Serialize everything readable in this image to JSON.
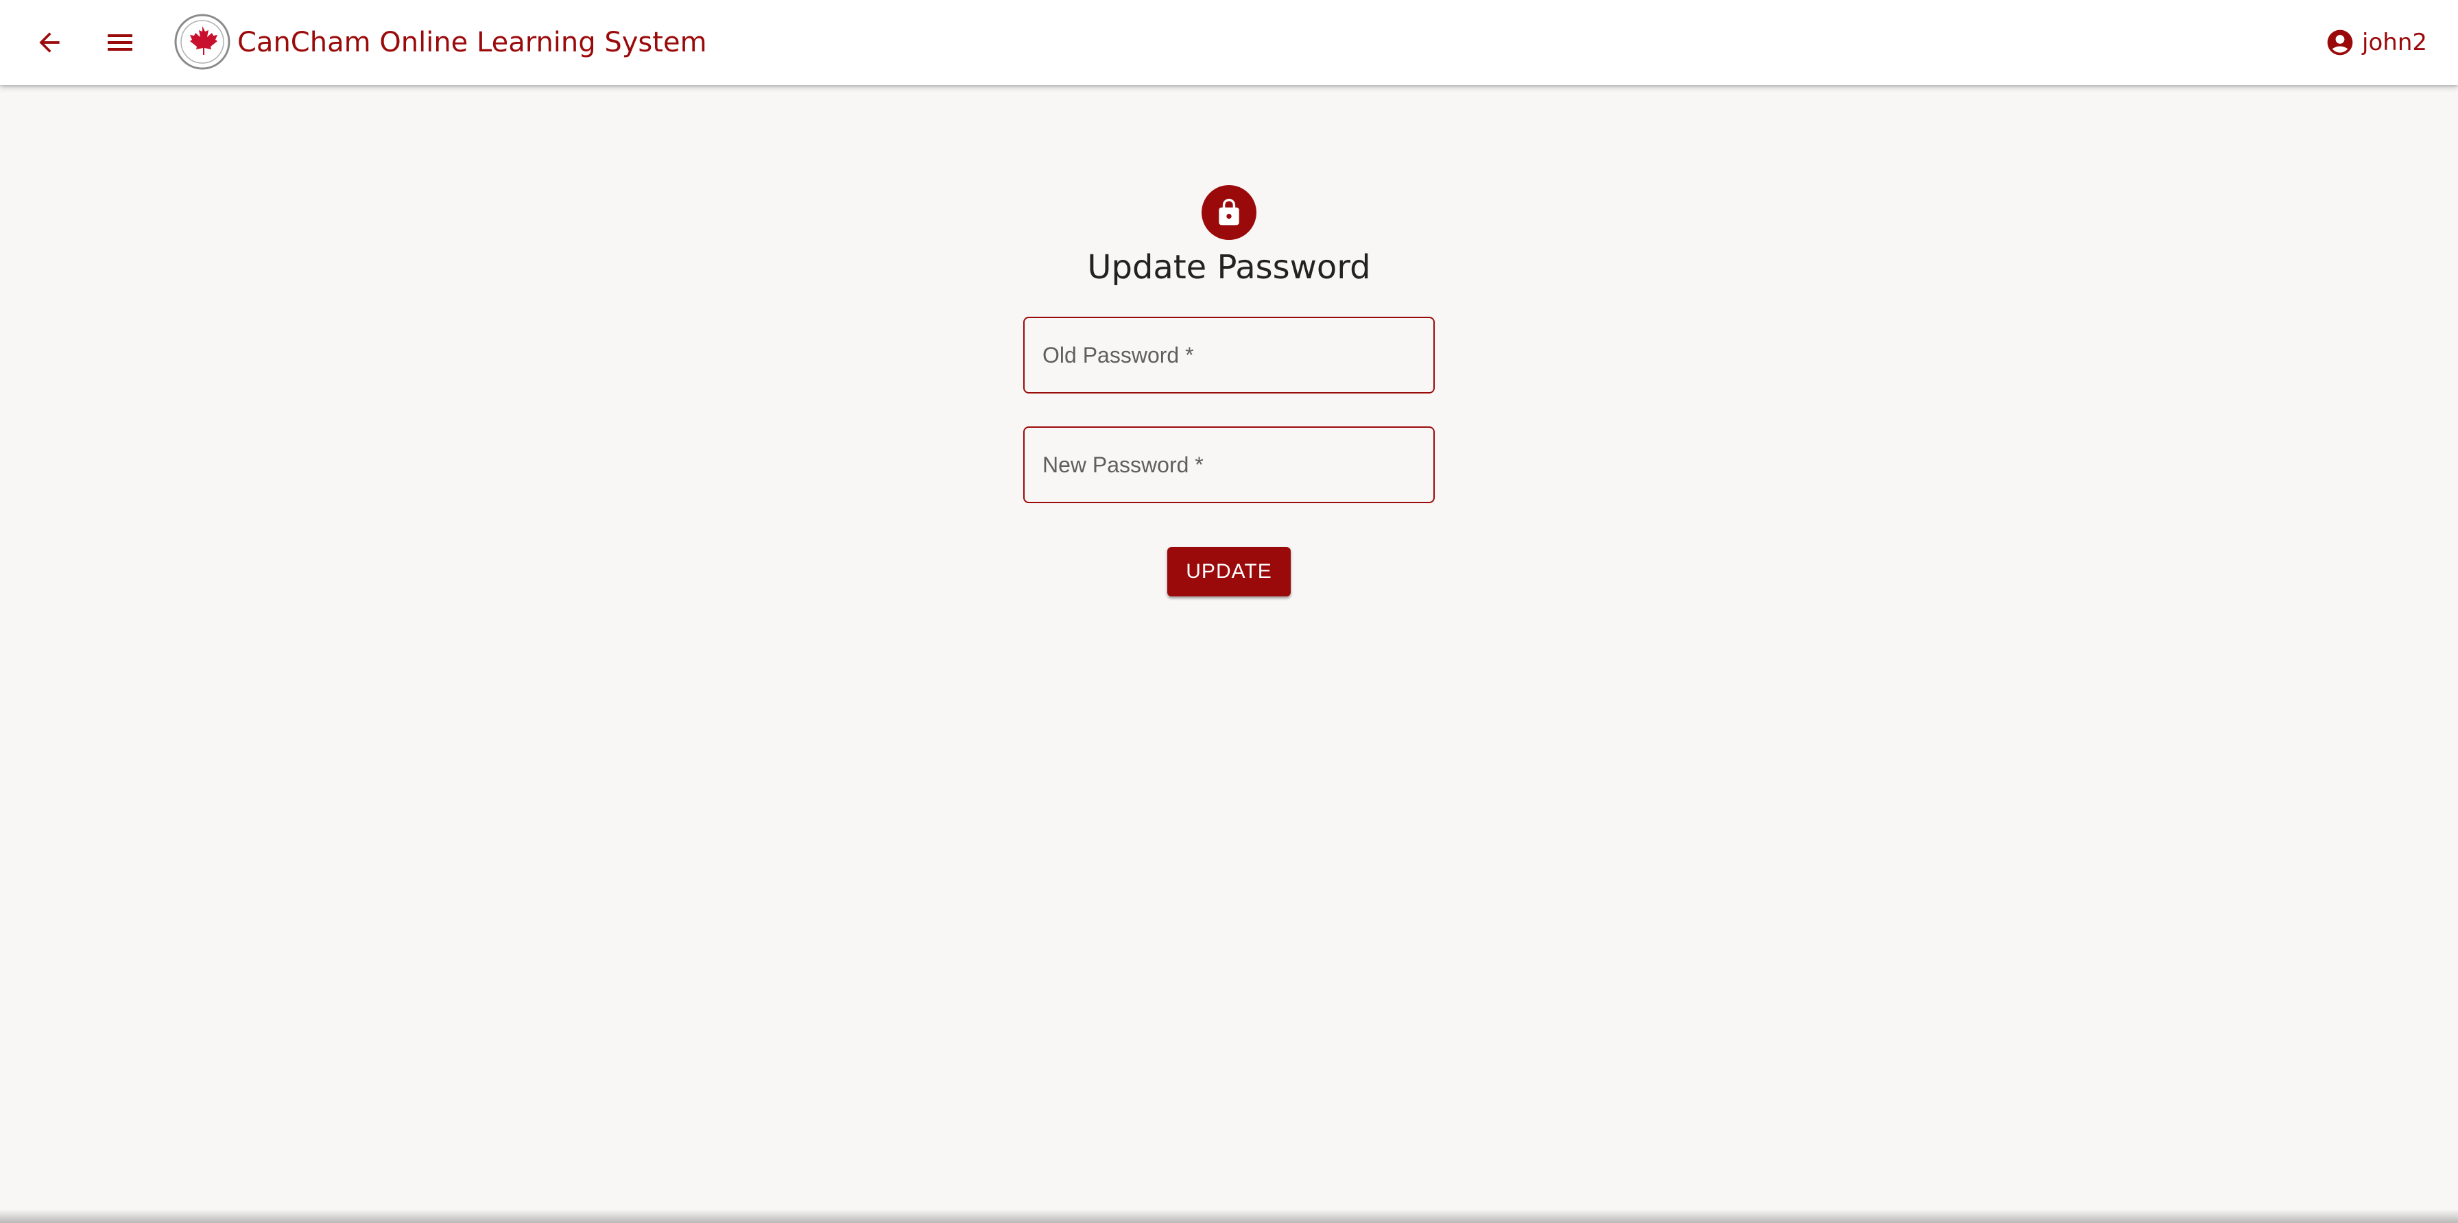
{
  "app": {
    "title": "CanCham Online Learning System",
    "logo_icon": "cancham-maple-leaf-seal",
    "back_icon": "arrow-back-icon",
    "menu_icon": "hamburger-menu-icon"
  },
  "user": {
    "name": "john2",
    "icon": "account-circle-icon"
  },
  "form": {
    "icon": "lock-icon",
    "title": "Update Password",
    "old_password_label": "Old Password *",
    "new_password_label": "New Password *",
    "submit_label": "UPDATE"
  },
  "colors": {
    "brand": "#9b0a0a",
    "background": "#f8f7f6",
    "appbar": "#ffffff"
  }
}
